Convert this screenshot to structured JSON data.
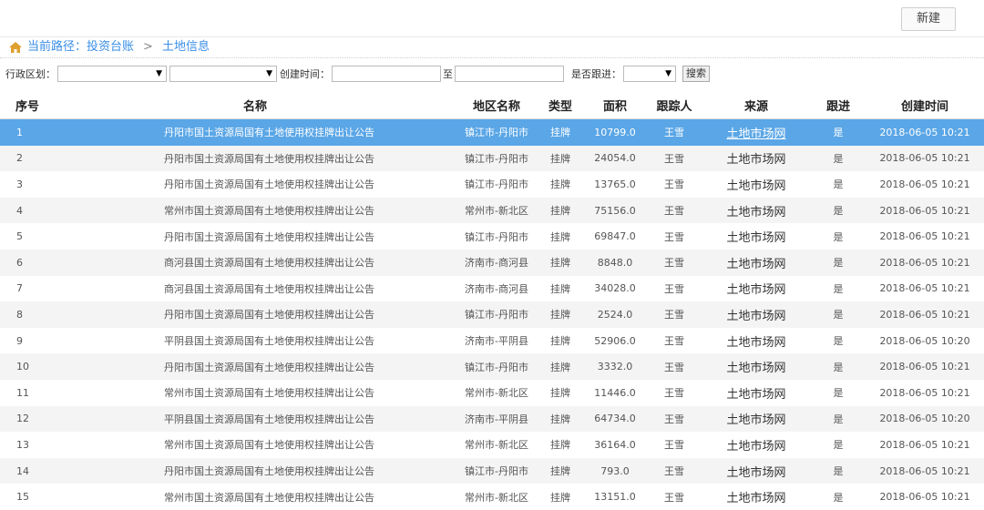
{
  "toolbar": {
    "new_label": "新建"
  },
  "breadcrumb": {
    "prefix": "当前路径：",
    "items": [
      "投资台账",
      "土地信息"
    ],
    "separator": ">"
  },
  "filters": {
    "region_label": "行政区划：",
    "select_arrow": "▼",
    "created_label": "创建时间：",
    "to_label": "至",
    "follow_label": "是否跟进：",
    "search_label": "搜索"
  },
  "table": {
    "headers": [
      "序号",
      "名称",
      "地区名称",
      "类型",
      "面积",
      "跟踪人",
      "来源",
      "跟进",
      "创建时间"
    ],
    "rows": [
      [
        "1",
        "丹阳市国土资源局国有土地使用权挂牌出让公告",
        "镇江市-丹阳市",
        "挂牌",
        "10799.0",
        "王雪",
        "土地市场网",
        "是",
        "2018-06-05 10:21"
      ],
      [
        "2",
        "丹阳市国土资源局国有土地使用权挂牌出让公告",
        "镇江市-丹阳市",
        "挂牌",
        "24054.0",
        "王雪",
        "土地市场网",
        "是",
        "2018-06-05 10:21"
      ],
      [
        "3",
        "丹阳市国土资源局国有土地使用权挂牌出让公告",
        "镇江市-丹阳市",
        "挂牌",
        "13765.0",
        "王雪",
        "土地市场网",
        "是",
        "2018-06-05 10:21"
      ],
      [
        "4",
        "常州市国土资源局国有土地使用权挂牌出让公告",
        "常州市-新北区",
        "挂牌",
        "75156.0",
        "王雪",
        "土地市场网",
        "是",
        "2018-06-05 10:21"
      ],
      [
        "5",
        "丹阳市国土资源局国有土地使用权挂牌出让公告",
        "镇江市-丹阳市",
        "挂牌",
        "69847.0",
        "王雪",
        "土地市场网",
        "是",
        "2018-06-05 10:21"
      ],
      [
        "6",
        "商河县国土资源局国有土地使用权挂牌出让公告",
        "济南市-商河县",
        "挂牌",
        "8848.0",
        "王雪",
        "土地市场网",
        "是",
        "2018-06-05 10:21"
      ],
      [
        "7",
        "商河县国土资源局国有土地使用权挂牌出让公告",
        "济南市-商河县",
        "挂牌",
        "34028.0",
        "王雪",
        "土地市场网",
        "是",
        "2018-06-05 10:21"
      ],
      [
        "8",
        "丹阳市国土资源局国有土地使用权挂牌出让公告",
        "镇江市-丹阳市",
        "挂牌",
        "2524.0",
        "王雪",
        "土地市场网",
        "是",
        "2018-06-05 10:21"
      ],
      [
        "9",
        "平阴县国土资源局国有土地使用权挂牌出让公告",
        "济南市-平阴县",
        "挂牌",
        "52906.0",
        "王雪",
        "土地市场网",
        "是",
        "2018-06-05 10:20"
      ],
      [
        "10",
        "丹阳市国土资源局国有土地使用权挂牌出让公告",
        "镇江市-丹阳市",
        "挂牌",
        "3332.0",
        "王雪",
        "土地市场网",
        "是",
        "2018-06-05 10:21"
      ],
      [
        "11",
        "常州市国土资源局国有土地使用权挂牌出让公告",
        "常州市-新北区",
        "挂牌",
        "11446.0",
        "王雪",
        "土地市场网",
        "是",
        "2018-06-05 10:21"
      ],
      [
        "12",
        "平阴县国土资源局国有土地使用权挂牌出让公告",
        "济南市-平阴县",
        "挂牌",
        "64734.0",
        "王雪",
        "土地市场网",
        "是",
        "2018-06-05 10:20"
      ],
      [
        "13",
        "常州市国土资源局国有土地使用权挂牌出让公告",
        "常州市-新北区",
        "挂牌",
        "36164.0",
        "王雪",
        "土地市场网",
        "是",
        "2018-06-05 10:21"
      ],
      [
        "14",
        "丹阳市国土资源局国有土地使用权挂牌出让公告",
        "镇江市-丹阳市",
        "挂牌",
        "793.0",
        "王雪",
        "土地市场网",
        "是",
        "2018-06-05 10:21"
      ],
      [
        "15",
        "常州市国土资源局国有土地使用权挂牌出让公告",
        "常州市-新北区",
        "挂牌",
        "13151.0",
        "王雪",
        "土地市场网",
        "是",
        "2018-06-05 10:21"
      ]
    ]
  },
  "colors": {
    "accent": "#3a8ee6",
    "selected_row": "#5aa6e6",
    "stripe": "#f4f4f4",
    "home_icon": "#e0a030"
  },
  "icons": {
    "home": "home-icon"
  }
}
